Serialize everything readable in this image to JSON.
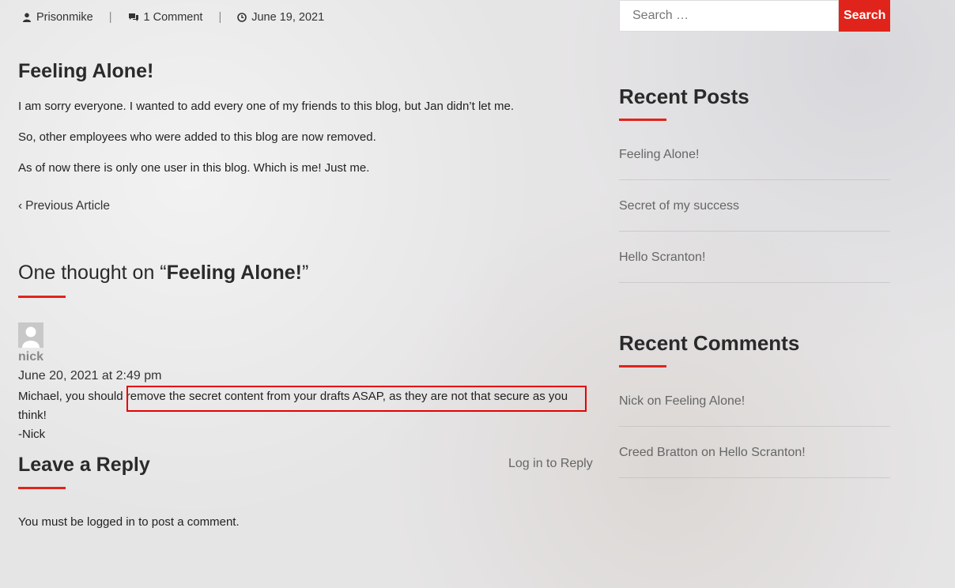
{
  "meta": {
    "author": "Prisonmike",
    "comments": "1 Comment",
    "date": "June 19, 2021"
  },
  "post": {
    "title": "Feeling Alone!",
    "paragraphs": [
      "I am sorry everyone. I wanted to add every one of my friends to this blog, but Jan didn’t let me.",
      "So, other employees who were added to this blog are now removed.",
      "As of now there is only one user in this blog. Which is me! Just me."
    ],
    "prev_label": "Previous Article"
  },
  "comments_section": {
    "heading_prefix": "One thought on “",
    "heading_title": "Feeling Alone!",
    "heading_suffix": "”",
    "comment": {
      "author": "nick",
      "date": "June 20, 2021 at 2:49 pm",
      "text": "Michael, you should remove the secret content from your drafts ASAP, as they are not that secure as you think!",
      "signature": "-Nick"
    },
    "highlight_color": "#e60000"
  },
  "reply": {
    "heading": "Leave a Reply",
    "login_link": "Log in to Reply",
    "must_prefix": "You must be ",
    "must_link": "logged in",
    "must_suffix": " to post a comment."
  },
  "sidebar": {
    "search_placeholder": "Search …",
    "search_button": "Search",
    "recent_posts_heading": "Recent Posts",
    "recent_posts": [
      "Feeling Alone!",
      "Secret of my success",
      "Hello Scranton!"
    ],
    "recent_comments_heading": "Recent Comments",
    "recent_comments": [
      {
        "author": "Nick",
        "on": "on",
        "post": "Feeling Alone!"
      },
      {
        "author": "Creed Bratton",
        "on": "on",
        "post": "Hello Scranton!"
      }
    ]
  },
  "colors": {
    "accent": "#e0241b"
  }
}
